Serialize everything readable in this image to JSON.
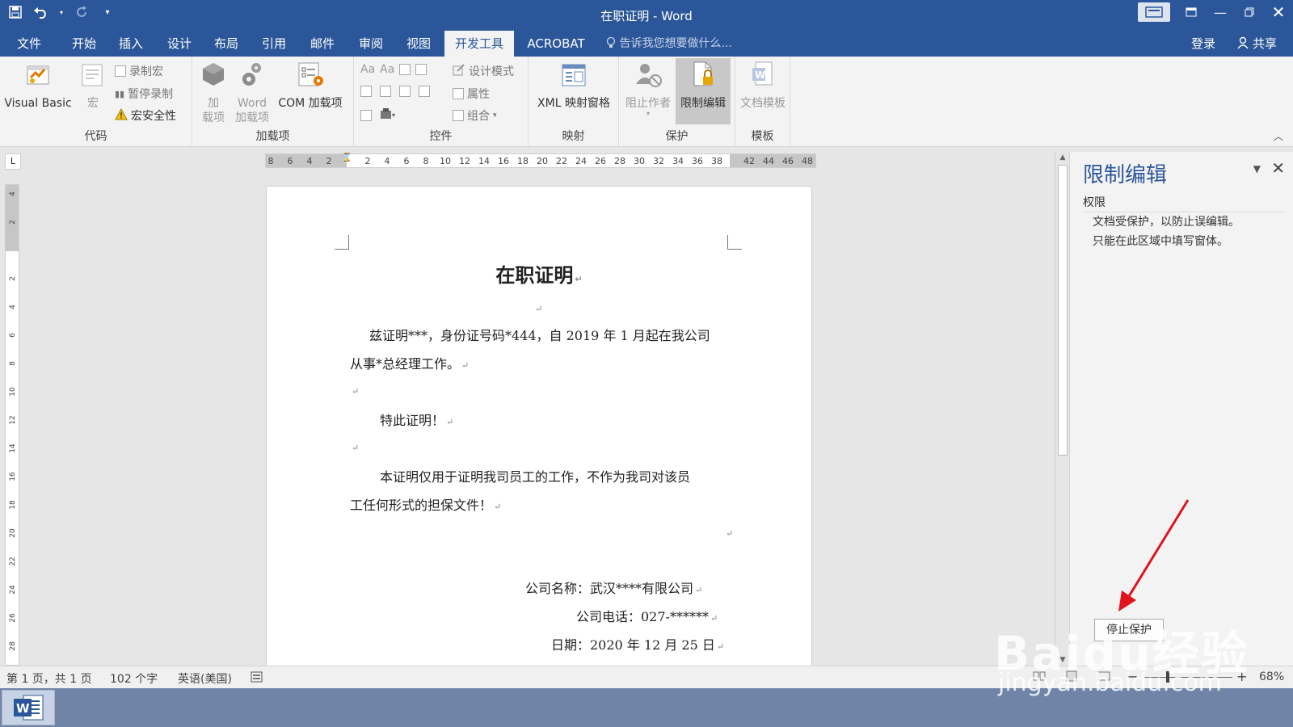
{
  "window": {
    "title": "在职证明 - Word"
  },
  "tabs": [
    "文件",
    "开始",
    "插入",
    "设计",
    "布局",
    "引用",
    "邮件",
    "审阅",
    "视图",
    "开发工具",
    "ACROBAT"
  ],
  "active_tab": "开发工具",
  "tell_me": "告诉我您想要做什么...",
  "account": {
    "login": "登录",
    "share": "共享"
  },
  "ribbon": {
    "code": {
      "label": "代码",
      "visual_basic": "Visual Basic",
      "macros": "宏",
      "record_macro": "录制宏",
      "pause_recording": "暂停录制",
      "macro_security": "宏安全性"
    },
    "addins": {
      "label": "加载项",
      "addins_l1": "加",
      "addins_l2": "载项",
      "word_addins_l1": "Word",
      "word_addins_l2": "加载项",
      "com_addins": "COM 加载项"
    },
    "controls": {
      "label": "控件",
      "design_mode": "设计模式",
      "properties": "属性",
      "group": "组合"
    },
    "mapping": {
      "label": "映射",
      "xml_pane": "XML 映射窗格"
    },
    "protect": {
      "label": "保护",
      "block_authors": "阻止作者",
      "restrict_editing": "限制编辑"
    },
    "templates": {
      "label": "模板",
      "document_template": "文档模板"
    }
  },
  "ruler": {
    "horizontal": [
      "8",
      "6",
      "4",
      "2",
      "2",
      "4",
      "6",
      "8",
      "10",
      "12",
      "14",
      "16",
      "18",
      "20",
      "22",
      "24",
      "26",
      "28",
      "30",
      "32",
      "34",
      "36",
      "38",
      "42",
      "44",
      "46",
      "48"
    ],
    "vertical": [
      "4",
      "2",
      "",
      "2",
      "4",
      "6",
      "8",
      "10",
      "12",
      "14",
      "16",
      "18",
      "20",
      "22",
      "24",
      "26",
      "28"
    ]
  },
  "document": {
    "title": "在职证明",
    "p1_line1": "兹证明***，身份证号码*444，自 2019 年 1 月起在我公司",
    "p1_line2": "从事*总经理工作。",
    "p2": "特此证明！",
    "p3_line1": "本证明仅用于证明我司员工的工作，不作为我司对该员",
    "p3_line2": "工任何形式的担保文件！",
    "company": "公司名称：武汉****有限公司",
    "phone": "公司电话：027-******",
    "date": "日期：2020 年 12 月 25 日",
    "para_mark": "↵"
  },
  "task_pane": {
    "title": "限制编辑",
    "section": "权限",
    "line1": "文档受保护，以防止误编辑。",
    "line2": "只能在此区域中填写窗体。",
    "stop_button": "停止保护"
  },
  "status_bar": {
    "page": "第 1 页，共 1 页",
    "words": "102 个字",
    "language": "英语(美国)",
    "zoom": "68%"
  },
  "watermark": {
    "brand": "Baidu经验",
    "url": "jingyan.baidu.com"
  },
  "colors": {
    "accent": "#2b579a",
    "ribbon_bg": "#f3f3f3",
    "arrow": "#e0141e"
  }
}
